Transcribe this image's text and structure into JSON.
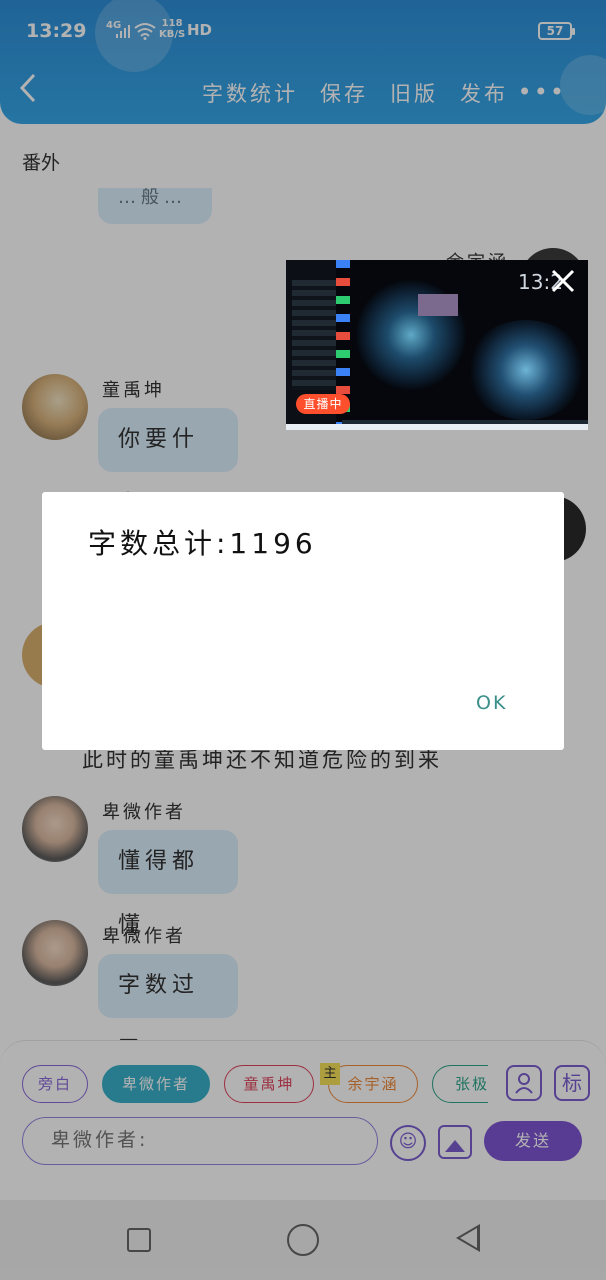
{
  "status_bar": {
    "time": "13:29",
    "network": "4G",
    "speed_value": "118",
    "speed_unit": "KB/S",
    "hd": "HD",
    "battery": "57"
  },
  "header": {
    "actions": [
      "字数统计",
      "保存",
      "旧版",
      "发布"
    ],
    "more": "•••"
  },
  "chapter_title": "番外",
  "messages": [
    {
      "name": "童禹坤",
      "text": "你要什么"
    },
    {
      "name": "卑微作者",
      "text": "懂得都懂"
    },
    {
      "name": "卑微作者",
      "text": "字数过了"
    }
  ],
  "partial_texts": {
    "top_bubble": "…般…",
    "right_name": "余宇涵",
    "narration": "此时的童禹坤还不知道危险的到来"
  },
  "live_window": {
    "badge": "直播中",
    "time": "13:2"
  },
  "dialog": {
    "text": "字数总计:1196",
    "ok": "OK"
  },
  "input_panel": {
    "chips": [
      {
        "label": "旁白",
        "color": "#8b6ad8"
      },
      {
        "label": "卑微作者",
        "color": "#38b0c9",
        "selected": true
      },
      {
        "label": "童禹坤",
        "color": "#e0455f"
      },
      {
        "label": "余宇涵",
        "color": "#f08a3c",
        "tag": "主"
      },
      {
        "label": "张极",
        "color": "#2fa58a"
      }
    ],
    "side_icon_text": "标",
    "placeholder": "卑微作者:",
    "send": "发送"
  }
}
